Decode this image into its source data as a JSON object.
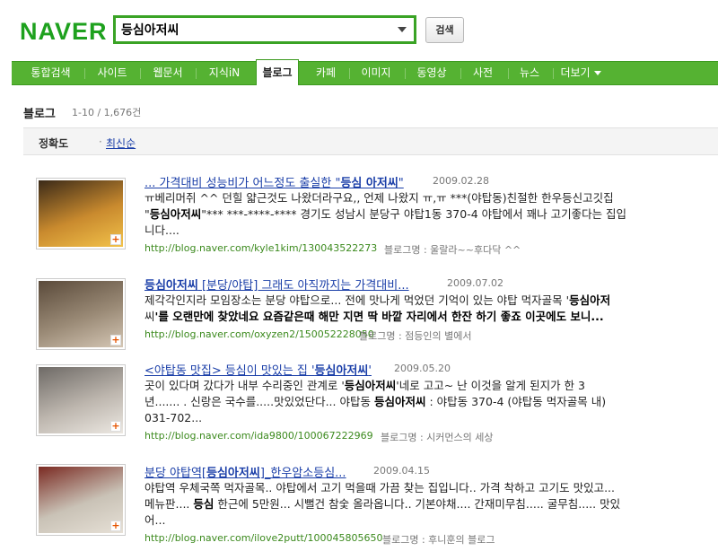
{
  "header": {
    "logo": "NAVER",
    "search_value": "등심아저씨",
    "search_button": "검색"
  },
  "nav": [
    {
      "label": "통합검색",
      "active": false
    },
    {
      "label": "사이트",
      "active": false
    },
    {
      "label": "웹문서",
      "active": false
    },
    {
      "label": "지식iN",
      "active": false
    },
    {
      "label": "블로그",
      "active": true
    },
    {
      "label": "카페",
      "active": false
    },
    {
      "label": "이미지",
      "active": false
    },
    {
      "label": "동영상",
      "active": false
    },
    {
      "label": "사전",
      "active": false
    },
    {
      "label": "뉴스",
      "active": false
    },
    {
      "label": "더보기",
      "active": false
    }
  ],
  "section": {
    "title": "블로그",
    "count": "1-10 / 1,676건"
  },
  "sort": {
    "accuracy": "정확도",
    "separator": "·",
    "latest": "최신순"
  },
  "results": [
    {
      "title_pre": "... 가격대비 성능비가 어느정도 출실한 \"",
      "title_bold": "등심 아저씨",
      "title_post": "\"",
      "date": "2009.02.28",
      "body_lines": [
        [
          "ㅠ베리머쥐 ^^ 던힐 얇근것도 나왔더라구요,, 언제 나왔지 ㅠ,ㅠ ***(야탑동)친절한 한우등신고깃집",
          ""
        ],
        [
          "\"",
          "등심아저씨",
          "\"*** ***-****-**** 경기도 성남시 분당구 야탑1동 370-4 야탑에서 꽤나 고기좋다는 집입"
        ],
        [
          "니다....",
          ""
        ]
      ],
      "url": "http://blog.naver.com/kyle1kim/130043522273",
      "blogname": "블로그명 : 울랄라~~후다닥 ^^",
      "thumb_colors": [
        "#3b2a18",
        "#c98a2e",
        "#f2c24a"
      ]
    },
    {
      "title_pre": "",
      "title_bold": "등심아저씨",
      "title_post": " [분당/야탑] 그래도 아직까지는 가격대비...",
      "date": "2009.07.02",
      "body_lines": [
        [
          "제각각인지라 모임장소는 분당 야탑으로... 전에 맛나게 먹었던 기억이 있는 야탑 먹자골목 '",
          "등심아저"
        ],
        [
          "씨",
          "'를 오랜만에 찾았네요 요즘같은때 해만 지면 딱 바깥 자리에서 한잔 하기 좋죠 이곳에도 보니..."
        ]
      ],
      "url": "http://blog.naver.com/oxyzen2/150052228050",
      "blogname": "블로그명 : 점등인의 별에서",
      "thumb_colors": [
        "#5a4a3a",
        "#9a8a76",
        "#d4c6b4"
      ]
    },
    {
      "title_pre": "<야탑동 맛집> 등심이 맛있는 집 '",
      "title_bold": "등심아저씨",
      "title_post": "'",
      "date": "2009.05.20",
      "body_lines": [
        [
          "곳이 있다며 갔다가 내부 수리중인 관계로 '",
          "등심아저씨",
          "'네로 고고~ 난 이것을 알게 된지가 한 3"
        ],
        [
          "년....... . 신랑은 국수를.....맛있었단다... 야탑동 ",
          "등심아저씨",
          " : 야탑동 370-4 (야탑동 먹자골목 내)"
        ],
        [
          "031-702...",
          ""
        ]
      ],
      "url": "http://blog.naver.com/ida9800/100067222969",
      "blogname": "블로그명 : 시커먼스의 세상",
      "thumb_colors": [
        "#6e6a66",
        "#bdb6ae",
        "#ece8e2"
      ]
    },
    {
      "title_pre": "분당 야탑역[",
      "title_bold": "등심아저씨",
      "title_post": "]_한우암소등심...",
      "date": "2009.04.15",
      "body_lines": [
        [
          "야탑역 우체국쪽 먹자골목.. 야탑에서 고기 먹을때 가끔 찾는 집입니다.. 가격 착하고 고기도 맛있고...",
          ""
        ],
        [
          "메뉴판.... ",
          "등심",
          " 한근에 5만원... 시뻘건 참숯 올라옵니다.. 기본야채.... 간재미무침..... 굴무침..... 맛있"
        ],
        [
          "어...",
          ""
        ]
      ],
      "url": "http://blog.naver.com/ilove2putt/100045805650",
      "blogname": "블로그명 : 후니훈의 블로그",
      "thumb_colors": [
        "#7a2a22",
        "#c9c2b6",
        "#e6e0d6"
      ]
    }
  ]
}
